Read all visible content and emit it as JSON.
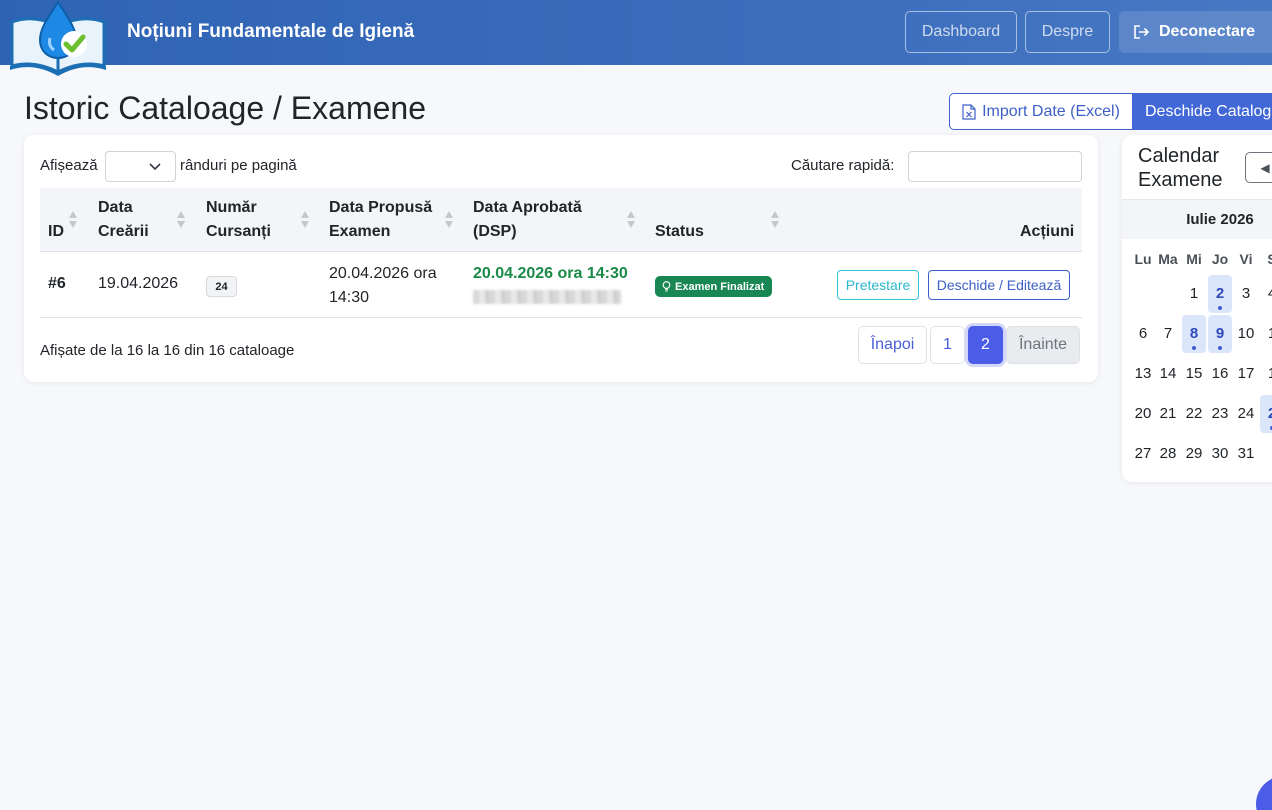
{
  "navbar": {
    "brand": "Noțiuni Fundamentale de Igienă",
    "dashboard_label": "Dashboard",
    "despre_label": "Despre",
    "logout_label": "Deconectare"
  },
  "page": {
    "title": "Istoric Cataloage / Examene",
    "import_label": "Import Date (Excel)",
    "open_label": "Deschide Catalog"
  },
  "table_controls": {
    "show_label": "Afișează",
    "rows_per_page_label": "rânduri pe pagină",
    "search_label": "Căutare rapidă:"
  },
  "table": {
    "headers": {
      "id": "ID",
      "created_1": "Data",
      "created_2": "Creării",
      "count_1": "Număr",
      "count_2": "Cursanți",
      "proposed_1": "Data Propusă",
      "proposed_2": "Examen",
      "approved_1": "Data Aprobată",
      "approved_2": "(DSP)",
      "status": "Status",
      "actions": "Acțiuni"
    },
    "rows": [
      {
        "id": "#6",
        "created": "19.04.2026",
        "count": "24",
        "proposed_1": "20.04.2026 ora",
        "proposed_2": "14:30",
        "approved": "20.04.2026 ora 14:30",
        "status": "Examen Finalizat",
        "pretest_label": "Pretestare",
        "edit_label": "Deschide / Editează"
      }
    ],
    "info": "Afișate de la 16 la 16 din 16 cataloage"
  },
  "pagination": {
    "prev": "Înapoi",
    "page1": "1",
    "page2": "2",
    "next": "Înainte",
    "current": 2
  },
  "calendar": {
    "title": "Calendar Examene",
    "month": "Iulie 2026",
    "weekdays": [
      "Lu",
      "Ma",
      "Mi",
      "Jo",
      "Vi",
      "S"
    ],
    "weeks": [
      [
        "",
        "",
        "1",
        "2",
        "3",
        "4"
      ],
      [
        "6",
        "7",
        "8",
        "9",
        "10",
        "1"
      ],
      [
        "13",
        "14",
        "15",
        "16",
        "17",
        "1"
      ],
      [
        "20",
        "21",
        "22",
        "23",
        "24",
        "2"
      ],
      [
        "27",
        "28",
        "29",
        "30",
        "31",
        ""
      ]
    ],
    "exam_days": [
      "2",
      "8",
      "9"
    ]
  },
  "colors": {
    "navbar": "#3b6dbd",
    "primary": "#4168d6",
    "success": "#198754",
    "info": "#2fc6d8"
  }
}
